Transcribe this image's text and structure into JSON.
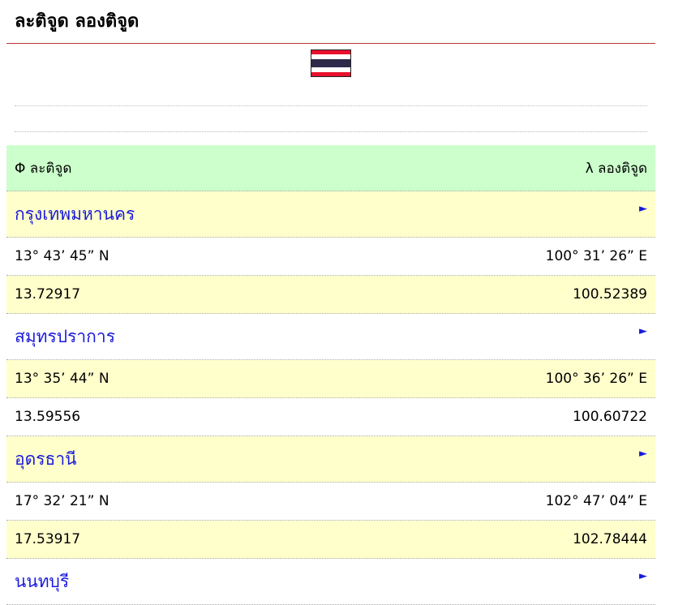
{
  "page": {
    "title": "ละติจูด ลองติจูด"
  },
  "colors": {
    "header_bg": "#ccffcc",
    "alt_row_bg": "#ffffcc",
    "link": "#1a1adb",
    "title_rule": "#b33333"
  },
  "table": {
    "lat_header": "Φ ละติจูด",
    "lon_header": "λ ลองติจูด",
    "arrow_glyph": "►",
    "cities": [
      {
        "name": "กรุงเทพมหานคร",
        "lat_dms": "13° 43’ 45” N",
        "lon_dms": "100° 31’ 26” E",
        "lat_dec": "13.72917",
        "lon_dec": "100.52389"
      },
      {
        "name": "สมุทรปราการ",
        "lat_dms": "13° 35’ 44” N",
        "lon_dms": "100° 36’ 26” E",
        "lat_dec": "13.59556",
        "lon_dec": "100.60722"
      },
      {
        "name": "อุดรธานี",
        "lat_dms": "17° 32’ 21” N",
        "lon_dms": "102° 47’ 04” E",
        "lat_dec": "17.53917",
        "lon_dec": "102.78444"
      },
      {
        "name": "นนทบุรี"
      }
    ]
  }
}
